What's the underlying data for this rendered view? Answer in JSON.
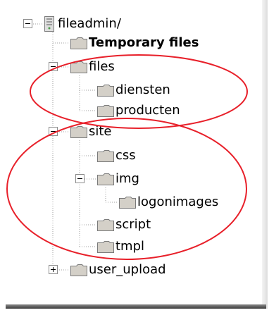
{
  "tree": {
    "root": {
      "label": "fileadmin/",
      "icon": "server-folder-icon",
      "expanded": true
    },
    "items": [
      {
        "label": "Temporary files",
        "bold": true,
        "icon": "folder-icon"
      },
      {
        "label": "files",
        "icon": "folder-icon",
        "expanded": true,
        "children": [
          {
            "label": "diensten",
            "icon": "folder-icon"
          },
          {
            "label": "producten",
            "icon": "folder-icon"
          }
        ]
      },
      {
        "label": "site",
        "icon": "folder-icon",
        "expanded": true,
        "children": [
          {
            "label": "css",
            "icon": "folder-icon"
          },
          {
            "label": "img",
            "icon": "folder-icon",
            "expanded": true,
            "children": [
              {
                "label": "logonimages",
                "icon": "folder-icon"
              }
            ]
          },
          {
            "label": "script",
            "icon": "folder-icon"
          },
          {
            "label": "tmpl",
            "icon": "folder-icon"
          }
        ]
      },
      {
        "label": "user_upload",
        "icon": "folder-icon",
        "expanded": false
      }
    ]
  },
  "annotations": {
    "color": "#e8202a",
    "shape": "ellipse"
  },
  "colors": {
    "folder_fill": "#d4d0c8",
    "folder_stroke": "#7a7a7a",
    "tree_line": "#a0a0a0",
    "toggle_border": "#8c8c8c"
  }
}
